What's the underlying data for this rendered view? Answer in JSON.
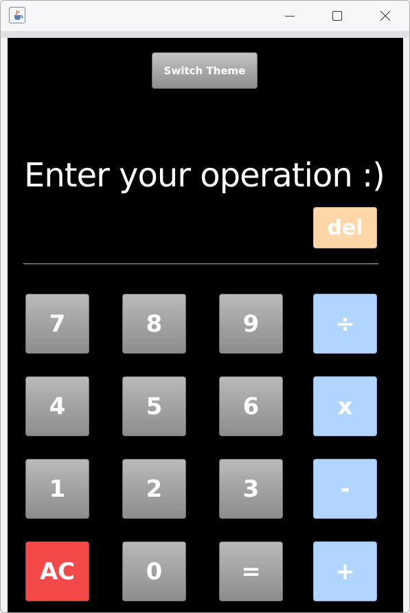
{
  "window": {
    "icon": "java-cup-icon",
    "controls": [
      "minimize-icon",
      "maximize-icon",
      "close-icon"
    ]
  },
  "toolbar": {
    "switch_theme_label": "Switch Theme"
  },
  "display": {
    "text": "Enter your operation :)"
  },
  "delete_label": "del",
  "keypad": {
    "rows": [
      [
        {
          "label": "7"
        },
        {
          "label": "8"
        },
        {
          "label": "9"
        },
        {
          "label": "÷"
        }
      ],
      [
        {
          "label": "4"
        },
        {
          "label": "5"
        },
        {
          "label": "6"
        },
        {
          "label": "x"
        }
      ],
      [
        {
          "label": "1"
        },
        {
          "label": "2"
        },
        {
          "label": "3"
        },
        {
          "label": "-"
        }
      ],
      [
        {
          "label": "AC"
        },
        {
          "label": "0"
        },
        {
          "label": "="
        },
        {
          "label": "+"
        }
      ]
    ]
  },
  "colors": {
    "background": "#000000",
    "number_key": "#9e9e9e",
    "operator_key": "#b0d6ff",
    "delete_key": "#ffd6a8",
    "clear_key": "#f54848",
    "text": "#ffffff"
  }
}
